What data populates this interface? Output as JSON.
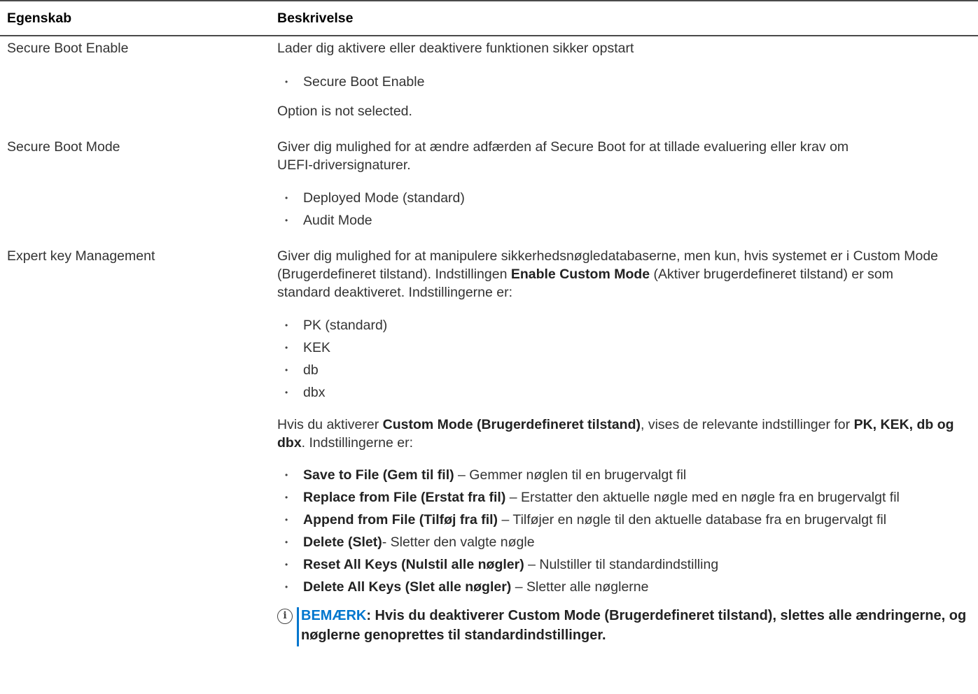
{
  "header": {
    "col1": "Egenskab",
    "col2": "Beskrivelse"
  },
  "rows": [
    {
      "property": "Secure Boot Enable",
      "intro": "Lader dig aktivere eller deaktivere funktionen sikker opstart",
      "options": [
        "Secure Boot Enable"
      ],
      "after": "Option is not selected."
    },
    {
      "property": "Secure Boot Mode",
      "intro_line1": "Giver dig mulighed for at ændre adfærden af Secure Boot for at tillade evaluering eller krav om",
      "intro_line2": "UEFI-driversignaturer.",
      "options": [
        "Deployed Mode (standard)",
        "Audit Mode"
      ]
    },
    {
      "property": "Expert key Management",
      "intro_a": "Giver dig mulighed for at manipulere sikkerhedsnøgledatabaserne, men kun, hvis systemet er i Custom Mode (Brugerdefineret tilstand). Indstillingen ",
      "intro_bold": "Enable Custom Mode",
      "intro_b": " (Aktiver brugerdefineret tilstand) er som standard deaktiveret. Indstillingerne er:",
      "options": [
        "PK (standard)",
        "KEK",
        "db",
        "dbx"
      ],
      "custom_a": "Hvis du aktiverer ",
      "custom_bold1": "Custom Mode (Brugerdefineret tilstand)",
      "custom_b": ", vises de relevante indstillinger for ",
      "custom_bold2": "PK, KEK, db og dbx",
      "custom_c": ". Indstillingerne er:",
      "actions": [
        {
          "label": "Save to File (Gem til fil)",
          "text": " – Gemmer nøglen til en brugervalgt fil"
        },
        {
          "label": "Replace from File (Erstat fra fil)",
          "text": " – Erstatter den aktuelle nøgle med en nøgle fra en brugervalgt fil"
        },
        {
          "label": "Append from File (Tilføj fra fil)",
          "text": " – Tilføjer en nøgle til den aktuelle database fra en brugervalgt fil"
        },
        {
          "label": "Delete (Slet)",
          "text": "- Sletter den valgte nøgle"
        },
        {
          "label": "Reset All Keys (Nulstil alle nøgler)",
          "text": " – Nulstiller til standardindstilling"
        },
        {
          "label": "Delete All Keys (Slet alle nøgler)",
          "text": " – Sletter alle nøglerne"
        }
      ],
      "note_label": "BEMÆRK",
      "note_text": ": Hvis du deaktiverer Custom Mode (Brugerdefineret tilstand), slettes alle ændringerne, og nøglerne genoprettes til standardindstillinger."
    }
  ],
  "icons": {
    "note": "info-icon",
    "bullet": "•"
  },
  "colors": {
    "accent": "#0076ce",
    "text": "#333333",
    "rule": "#4a4a4a"
  }
}
